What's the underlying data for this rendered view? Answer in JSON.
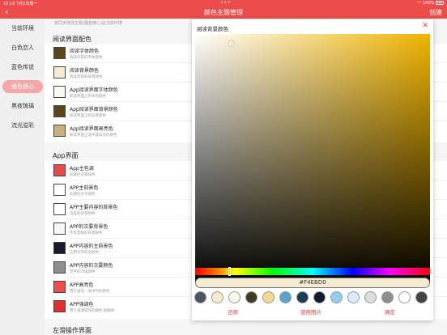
{
  "status": {
    "time": "10:16",
    "date": "7月1日周一",
    "dots": "•••",
    "battery": "100%"
  },
  "header": {
    "back_icon": "‹",
    "title": "颜色主题管理",
    "create": "创建"
  },
  "sidebar": {
    "items": [
      {
        "label": "当前环境",
        "active": false
      },
      {
        "label": "白色恋人",
        "active": false
      },
      {
        "label": "蓝色传说",
        "active": false
      },
      {
        "label": "骚色撩心",
        "active": true
      },
      {
        "label": "黑夜琉璃",
        "active": false
      },
      {
        "label": "流光溢彩",
        "active": false
      }
    ]
  },
  "main": {
    "hint": "将同步修改主题(骚色撩心)这当前环境",
    "section_reading": "阅读界面配色",
    "reading_rows": [
      {
        "title": "阅读字体颜色",
        "subtitle": "阅读内容的字体颜色",
        "color": "#5a4616"
      },
      {
        "title": "阅读背景颜色",
        "subtitle": "阅读内容的背景颜色",
        "color": "#f4ebd0"
      },
      {
        "title": "App阅读界面字体颜色",
        "subtitle": "阅读界面上字体的颜色",
        "color": "#fbf8ee"
      },
      {
        "title": "App阅读界面背景颜色",
        "subtitle": "阅读界面上的背景颜色",
        "color": "#5a4616"
      },
      {
        "title": "App阅读界面高亮色",
        "subtitle": "阅读界面上选中或高亮的颜色",
        "color": "#c9b17e"
      }
    ],
    "section_app": "App界面",
    "app_rows": [
      {
        "title": "App主色调",
        "subtitle": "标题栏背景颜色",
        "color": "#e84a4a"
      },
      {
        "title": "APP主前景色",
        "subtitle": "标题栏文字颜色",
        "color": "#ffffff"
      },
      {
        "title": "APP主要内容的背景色",
        "subtitle": "内容的背景颜色",
        "color": "#ffffff"
      },
      {
        "title": "APP的次要背景色",
        "subtitle": "不太显眼的背景颜色",
        "color": "#f7f7f7"
      },
      {
        "title": "APP内容的主前景色",
        "subtitle": "应用文字的主颜色",
        "color": "#161a2b"
      },
      {
        "title": "APP内容的次要颜色",
        "subtitle": "文字的次级颜色",
        "color": "#8d8f93"
      },
      {
        "title": "APP高亮色",
        "subtitle": "用于高亮、选中时的颜色",
        "color": "#ef4d4d"
      },
      {
        "title": "APP强调色",
        "subtitle": "用于强调操作的颜色,如删除",
        "color": "#e32e2e"
      }
    ],
    "section_slide": "左滑操作界面"
  },
  "dialog": {
    "title": "阅读背景颜色",
    "close_icon": "✕",
    "hue_color": "#f0b300",
    "hex_value": "#F4EBD0",
    "presets": [
      "#4a5561",
      "#f4ebd0",
      "#fbf8ee",
      "#3f3b28",
      "#f5d78e",
      "#5ba3c8",
      "#1b3d55",
      "#0d1e2c",
      "#8ecfee",
      "#d7eef8",
      "#dcdcdc",
      "#8e8e8e",
      "#ffffff",
      "#444444"
    ],
    "buttons": {
      "restore": "还原",
      "use_image": "使用图片",
      "confirm": "确定"
    }
  }
}
